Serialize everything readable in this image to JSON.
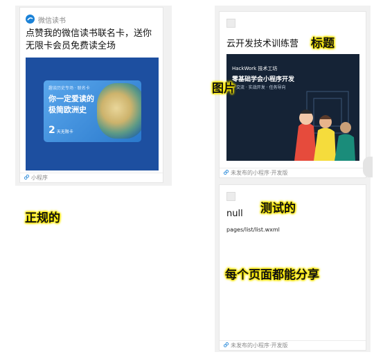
{
  "left_card": {
    "app_name": "微信读书",
    "title": "点赞我的微信读书联名卡，送你无限卡会员免费读全场",
    "promo": {
      "subtitle": "趣谈历史专场 · 联名卡",
      "headline_line1": "你一定爱读的",
      "headline_line2": "极简欧洲史",
      "days": "2",
      "days_unit": "天无限卡"
    },
    "footer": "小程序"
  },
  "right_top_card": {
    "title": "云开发技术训练营",
    "banner": {
      "brand": "HackWork 技术工坊",
      "headline": "零基础学会小程序开发",
      "tagline": "・交流 · 实战开发 · 任务导向"
    },
    "footer": "未发布的小程序·开发版"
  },
  "right_bottom_card": {
    "title": "null",
    "path": "pages/list/list.wxml",
    "footer": "未发布的小程序·开发版"
  },
  "annotations": {
    "title_label": "标题",
    "image_label": "图片",
    "normal_label": "正规的",
    "test_label": "测试的",
    "share_label": "每个页面都能分享"
  },
  "colors": {
    "wechat_read_blue": "#1b82d7",
    "promo_bg": "#1d4fa0",
    "banner_bg": "#152336",
    "highlight": "#f7e600"
  }
}
